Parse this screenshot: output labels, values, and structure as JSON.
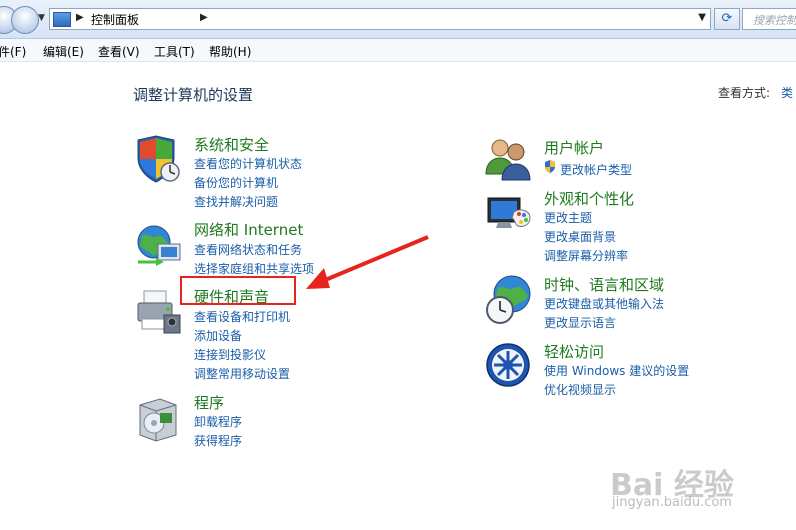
{
  "address_bar": {
    "breadcrumb": "控制面板",
    "search_placeholder": "搜索控制面板"
  },
  "menu": {
    "items": [
      "件(F)",
      "编辑(E)",
      "查看(V)",
      "工具(T)",
      "帮助(H)"
    ]
  },
  "main": {
    "title": "调整计算机的设置",
    "view_by_label": "查看方式:",
    "view_by_value": "类"
  },
  "categories": {
    "system": {
      "title": "系统和安全",
      "links": [
        "查看您的计算机状态",
        "备份您的计算机",
        "查找并解决问题"
      ],
      "icon": "shield-icon"
    },
    "network": {
      "title": "网络和 Internet",
      "links": [
        "查看网络状态和任务",
        "选择家庭组和共享选项"
      ],
      "icon": "network-globe-icon"
    },
    "hardware": {
      "title": "硬件和声音",
      "links": [
        "查看设备和打印机",
        "添加设备",
        "连接到投影仪",
        "调整常用移动设置"
      ],
      "icon": "printer-icon"
    },
    "programs": {
      "title": "程序",
      "links": [
        "卸载程序",
        "获得程序"
      ],
      "icon": "programs-box-icon"
    },
    "users": {
      "title": "用户帐户",
      "links": [
        "更改帐户类型"
      ],
      "icon": "users-icon"
    },
    "appearance": {
      "title": "外观和个性化",
      "links": [
        "更改主题",
        "更改桌面背景",
        "调整屏幕分辨率"
      ],
      "icon": "monitor-palette-icon"
    },
    "clock": {
      "title": "时钟、语言和区域",
      "links": [
        "更改键盘或其他输入法",
        "更改显示语言"
      ],
      "icon": "clock-globe-icon"
    },
    "ease": {
      "title": "轻松访问",
      "links": [
        "使用 Windows 建议的设置",
        "优化视频显示"
      ],
      "icon": "ease-of-access-icon"
    }
  },
  "watermark": {
    "logo": "Bai 经验",
    "url": "jingyan.baidu.com"
  },
  "colors": {
    "category_title": "#1e7a1e",
    "link": "#1a5ea8",
    "highlight": "#e8231d"
  }
}
